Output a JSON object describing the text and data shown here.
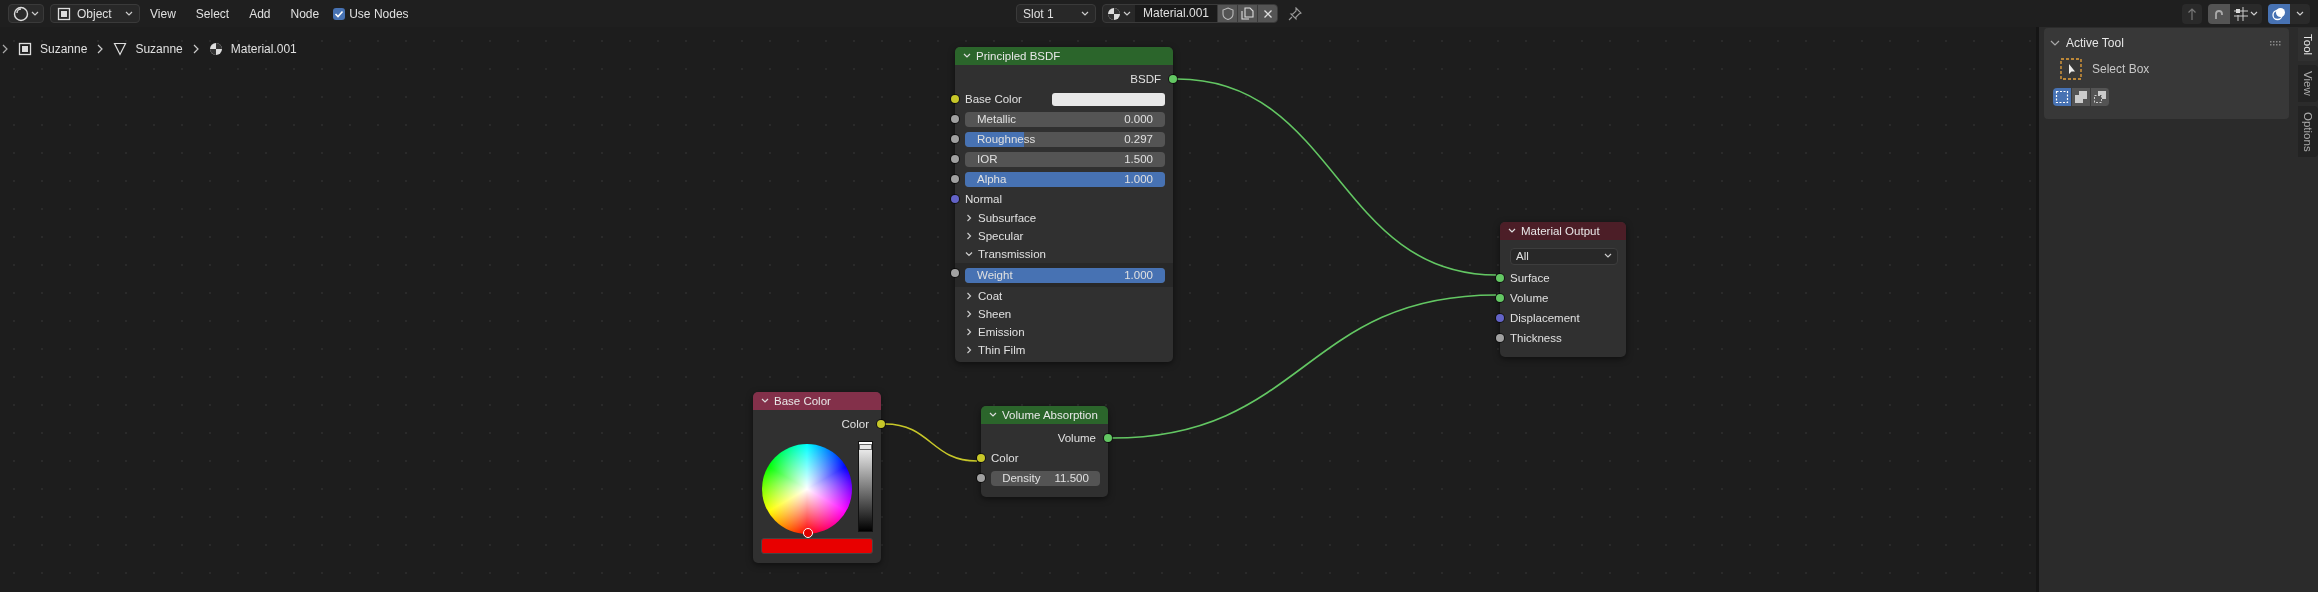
{
  "header": {
    "mode": "Object",
    "menus": [
      "View",
      "Select",
      "Add",
      "Node"
    ],
    "use_nodes": {
      "label": "Use Nodes",
      "checked": true
    },
    "slot": "Slot 1",
    "material": "Material.001",
    "overlays_on": true
  },
  "breadcrumbs": [
    {
      "kind": "object",
      "label": "Suzanne"
    },
    {
      "kind": "mesh",
      "label": "Suzanne"
    },
    {
      "kind": "material",
      "label": "Material.001"
    }
  ],
  "nodes": [
    {
      "title": "Principled BSDF",
      "color": "#2b652b",
      "rows": [
        {
          "kind": "output",
          "label": "BSDF",
          "color": "#63c763"
        },
        {
          "kind": "color_input",
          "label": "Base Color",
          "color": "#c7c729"
        },
        {
          "kind": "field",
          "label": "Metallic",
          "value": "0.000",
          "color": "#a1a1a1"
        },
        {
          "kind": "slider",
          "label": "Roughness",
          "value": "0.297",
          "level": 0.297,
          "color": "#a1a1a1"
        },
        {
          "kind": "field",
          "label": "IOR",
          "value": "1.500",
          "color": "#a1a1a1"
        },
        {
          "kind": "slider",
          "label": "Alpha",
          "value": "1.000",
          "level": 1,
          "color": "#a1a1a1"
        },
        {
          "kind": "input",
          "label": "Normal",
          "color": "#6363c7"
        },
        {
          "kind": "panel",
          "label": "Subsurface",
          "expanded": false
        },
        {
          "kind": "panel",
          "label": "Specular",
          "expanded": false
        },
        {
          "kind": "panel",
          "label": "Transmission",
          "expanded": true,
          "children": [
            {
              "kind": "slider",
              "label": "Weight",
              "value": "1.000",
              "level": 1,
              "color": "#a1a1a1"
            }
          ]
        },
        {
          "kind": "panel",
          "label": "Coat",
          "expanded": false
        },
        {
          "kind": "panel",
          "label": "Sheen",
          "expanded": false
        },
        {
          "kind": "panel",
          "label": "Emission",
          "expanded": false
        },
        {
          "kind": "panel",
          "label": "Thin Film",
          "expanded": false
        }
      ]
    },
    {
      "title": "Material Output",
      "color": "#4c1e27",
      "rows": [
        {
          "kind": "dropdown",
          "value": "All"
        },
        {
          "kind": "input",
          "label": "Surface",
          "color": "#63c763"
        },
        {
          "kind": "input",
          "label": "Volume",
          "color": "#63c763"
        },
        {
          "kind": "input",
          "label": "Displacement",
          "color": "#6363c7"
        },
        {
          "kind": "input",
          "label": "Thickness",
          "color": "#a1a1a1"
        }
      ]
    },
    {
      "title": "Base Color",
      "color": "#83304a",
      "rows": [
        {
          "kind": "output",
          "label": "Color",
          "color": "#c7c729"
        },
        {
          "kind": "color_picker",
          "level": 1
        }
      ]
    },
    {
      "title": "Volume Absorption",
      "color": "#2b652b",
      "rows": [
        {
          "kind": "output",
          "label": "Volume",
          "color": "#63c763"
        },
        {
          "kind": "input",
          "label": "Color",
          "color": "#c7c729"
        },
        {
          "kind": "number",
          "label": "Density",
          "value": "11.500",
          "color": "#a1a1a1"
        }
      ]
    }
  ],
  "sidebar": {
    "panel": {
      "title": "Active Tool",
      "expanded": true,
      "tool": "Select Box",
      "modes": [
        {
          "kind": "set",
          "selected": true
        },
        {
          "kind": "extend",
          "selected": false
        },
        {
          "kind": "subtract",
          "selected": false
        }
      ]
    },
    "tabs": [
      {
        "label": "Tool",
        "selected": true
      },
      {
        "label": "View",
        "selected": false
      },
      {
        "label": "Options",
        "selected": false
      }
    ]
  }
}
